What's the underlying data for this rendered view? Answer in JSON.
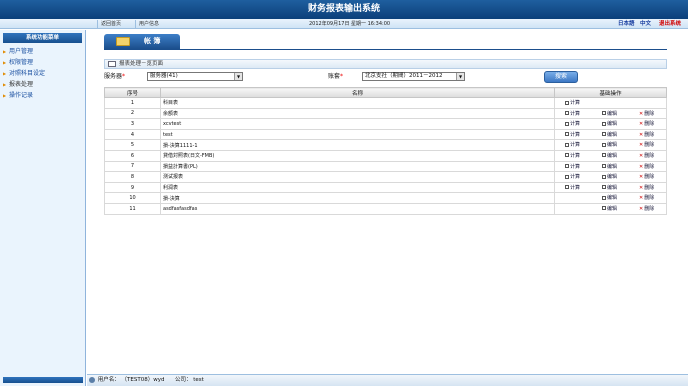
{
  "app": {
    "title": "财务报表输出系统"
  },
  "toolbar": {
    "home": "返回首页",
    "user_info": "用户信息",
    "datetime": "2012年09月17日 星期一 16:34:00",
    "lang_ja": "日本語",
    "lang_zh": "中文",
    "logout": "退出系统"
  },
  "sidebar": {
    "header": "系统功能菜单",
    "items": [
      {
        "label": "用户管理"
      },
      {
        "label": "权限管理"
      },
      {
        "label": "对照科目设定"
      },
      {
        "label": "报表处理"
      },
      {
        "label": "操作记录"
      }
    ]
  },
  "main": {
    "title": "帐 簿",
    "breadcrumb": "报表处理－览页面",
    "filters": {
      "server_label": "服务器",
      "server_value": "服务器(41)",
      "account_label": "账套",
      "account_value": "北京支社（期間）2011－2012",
      "required_mark": "*",
      "search_button": "搜索"
    },
    "table": {
      "headers": {
        "no": "序号",
        "name": "名称",
        "ops": "基础操作"
      },
      "ops_labels": {
        "calc": "计算",
        "edit": "编辑",
        "delete": "删除"
      },
      "rows": [
        {
          "no": "1",
          "name": "科目表",
          "calc": true,
          "edit": false,
          "del": false
        },
        {
          "no": "2",
          "name": "余额表",
          "calc": true,
          "edit": true,
          "del": true
        },
        {
          "no": "3",
          "name": "xcvtest",
          "calc": true,
          "edit": true,
          "del": true
        },
        {
          "no": "4",
          "name": "test",
          "calc": true,
          "edit": true,
          "del": true
        },
        {
          "no": "5",
          "name": "損-決算1111-1",
          "calc": true,
          "edit": true,
          "del": true
        },
        {
          "no": "6",
          "name": "貸借対照表(日文-FMB)",
          "calc": true,
          "edit": true,
          "del": true
        },
        {
          "no": "7",
          "name": "損益計算書(PL)",
          "calc": true,
          "edit": true,
          "del": true
        },
        {
          "no": "8",
          "name": "测试报表",
          "calc": true,
          "edit": true,
          "del": true
        },
        {
          "no": "9",
          "name": "利润表",
          "calc": true,
          "edit": true,
          "del": true
        },
        {
          "no": "10",
          "name": "損-決算",
          "calc": false,
          "edit": true,
          "del": true
        },
        {
          "no": "11",
          "name": "asdfasfasdfas",
          "calc": false,
          "edit": true,
          "del": true
        }
      ]
    }
  },
  "status": {
    "user_label": "用户名：",
    "user_value": "（TEST08）wyd",
    "company_label": "公司：",
    "company_value": "test"
  }
}
